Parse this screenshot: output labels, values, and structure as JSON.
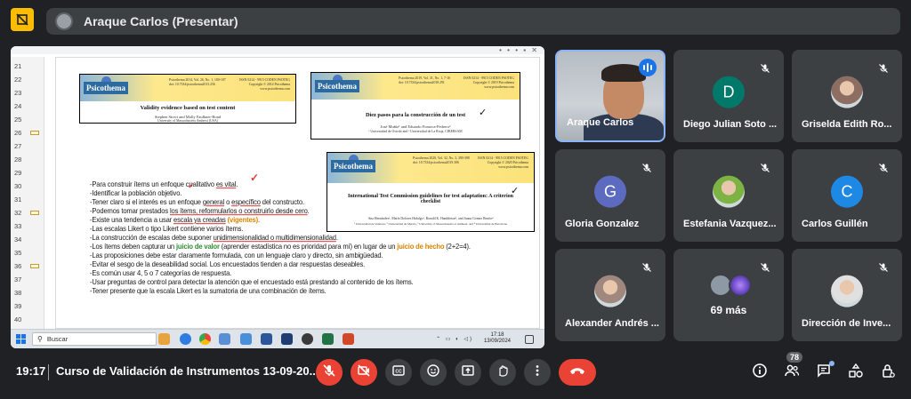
{
  "header": {
    "presenter_title": "Araque Carlos (Presentar)"
  },
  "slide": {
    "line_numbers": [
      "21",
      "22",
      "23",
      "24",
      "25",
      "26",
      "27",
      "28",
      "29",
      "30",
      "31",
      "32",
      "33",
      "34",
      "35",
      "36",
      "37",
      "38",
      "39",
      "40",
      "41"
    ],
    "covers": [
      {
        "logo": "Psicothema",
        "title": "Validity evidence based on test content",
        "authors": "Stephen Sireci and Molly Faulkner-Bond",
        "affiliation": "University of Massachusetts Amherst (USA)"
      },
      {
        "logo": "Psicothema",
        "title": "Diez pasos para la construcción de un test",
        "authors": "José Muñiz¹ and Eduardo Fonseca-Pedrero²",
        "affiliation": "¹ Universidad de Oviedo and ² Universidad de La Rioja, CIBERSAM"
      },
      {
        "logo": "Psicothema",
        "title": "International Test Commission guidelines for test adaptation: A criterion checklist",
        "authors": "Ana Hernández¹, María Dolores Hidalgo², Ronald K. Hambleton³, and Juana Gómez Benito⁴",
        "affiliation": "¹ Universidad de Valencia, ² Universidad de Murcia, ³ University of Massachusetts at Amherst, and ⁴ Universidad de Barcelona"
      }
    ],
    "bullets": [
      {
        "parts": [
          {
            "t": "-Para construir ítems un enfoque cualitativo "
          },
          {
            "t": "es vital",
            "s": "ul"
          },
          {
            "t": "."
          }
        ]
      },
      {
        "parts": [
          {
            "t": "-Identificar la población objetivo."
          }
        ]
      },
      {
        "parts": [
          {
            "t": "-Tener claro si el interés es un enfoque "
          },
          {
            "t": "general",
            "s": "ul"
          },
          {
            "t": " o "
          },
          {
            "t": "específico",
            "s": "ul"
          },
          {
            "t": " del constructo."
          }
        ]
      },
      {
        "parts": [
          {
            "t": "-Podemos tomar prestados "
          },
          {
            "t": "los ítems, reformularlos o construirlo desde cero",
            "s": "ul"
          },
          {
            "t": "."
          }
        ]
      },
      {
        "parts": [
          {
            "t": "-Existe una tendencia a usar "
          },
          {
            "t": "escala ya creadas",
            "s": "ul"
          },
          {
            "t": " "
          },
          {
            "t": "(vigentes)",
            "s": "orange"
          },
          {
            "t": "."
          }
        ]
      },
      {
        "parts": [
          {
            "t": "-Las escalas Likert o tipo Likert contiene varios ítems."
          }
        ]
      },
      {
        "parts": [
          {
            "t": "-La construcción de escalas debe suponer "
          },
          {
            "t": "unidimensionalidad o multidimensionalidad",
            "s": "ul"
          },
          {
            "t": "."
          }
        ]
      },
      {
        "parts": [
          {
            "t": "-Los ítems deben capturar un "
          },
          {
            "t": "juicio de valor",
            "s": "green"
          },
          {
            "t": " (aprender estadística no es prioridad para mí) en lugar de un "
          },
          {
            "t": "juicio de hecho",
            "s": "orange"
          },
          {
            "t": " (2+2=4)."
          }
        ]
      },
      {
        "parts": [
          {
            "t": "-Las proposiciones debe estar claramente formulada, con un lenguaje claro y directo, sin ambigüedad."
          }
        ]
      },
      {
        "parts": [
          {
            "t": "-Evitar el sesgo de la deseabilidad social. Los encuestados tienden a dar respuestas deseables."
          }
        ]
      },
      {
        "parts": [
          {
            "t": "-Es común usar 4, 5 o 7 categorías de respuesta."
          }
        ]
      },
      {
        "parts": [
          {
            "t": "-Usar preguntas de control para detectar la atención que el encuestado está prestando al contenido de los ítems."
          }
        ]
      },
      {
        "parts": [
          {
            "t": "-Tener presente que la escala Likert es la sumatoria de una combinación de ítems."
          }
        ]
      }
    ]
  },
  "taskbar": {
    "search_placeholder": "Buscar",
    "clock_time": "17:18",
    "clock_date": "13/09/2024"
  },
  "participants": [
    {
      "name": "Araque Carlos",
      "type": "speaker"
    },
    {
      "name": "Diego Julian Soto ...",
      "type": "letter",
      "letter": "D",
      "color": "#00796b"
    },
    {
      "name": "Griselda Edith Ro...",
      "type": "photo"
    },
    {
      "name": "Gloria Gonzalez",
      "type": "letter",
      "letter": "G",
      "color": "#5c6bc0"
    },
    {
      "name": "Estefania Vazquez...",
      "type": "photo"
    },
    {
      "name": "Carlos Guillén",
      "type": "letter",
      "letter": "C",
      "color": "#1e88e5"
    },
    {
      "name": "Alexander Andrés ...",
      "type": "photo"
    },
    {
      "name": "69 más",
      "type": "more"
    },
    {
      "name": "Dirección de Inve...",
      "type": "photo"
    }
  ],
  "bottom": {
    "time": "19:17",
    "meeting_title": "Curso de Validación de Instrumentos 13-09-20...",
    "people_count": "78"
  },
  "colors": {
    "background": "#202124",
    "tile": "#3c4043",
    "danger": "#ea4335",
    "accent": "#8ab4f8",
    "pin": "#fbbc04"
  },
  "icons": [
    "pin-icon",
    "mic-off-icon",
    "camera-off-icon",
    "captions-icon",
    "emoji-icon",
    "present-icon",
    "hand-icon",
    "more-vert-icon",
    "hangup-icon",
    "info-icon",
    "people-icon",
    "chat-icon",
    "activities-icon",
    "lock-icon"
  ]
}
